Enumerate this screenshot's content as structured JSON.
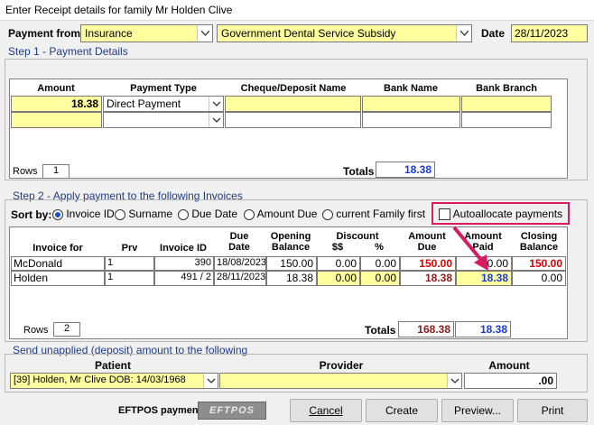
{
  "window": {
    "title": "Enter Receipt details for family Mr  Holden  Clive"
  },
  "header": {
    "payment_from_label": "Payment from",
    "payment_from_value": "Insurance",
    "payer_value": "Government Dental Service Subsidy",
    "date_label": "Date",
    "date_value": "28/11/2023"
  },
  "step1": {
    "title": "Step 1 - Payment Details",
    "columns": [
      "Amount",
      "Payment Type",
      "Cheque/Deposit Name",
      "Bank Name",
      "Bank Branch"
    ],
    "rows": [
      {
        "amount": "18.38",
        "payment_type": "Direct Payment",
        "cheque_name": "",
        "bank_name": "",
        "bank_branch": ""
      },
      {
        "amount": "",
        "payment_type": "",
        "cheque_name": "",
        "bank_name": "",
        "bank_branch": ""
      }
    ],
    "rows_label": "Rows",
    "rows_value": "1",
    "totals_label": "Totals",
    "totals_value": "18.38"
  },
  "step2": {
    "title": "Step 2 - Apply payment to the following Invoices",
    "sort_by_label": "Sort by:",
    "sort_options": [
      "Invoice ID",
      "Surname",
      "Due Date",
      "Amount Due",
      "current Family first"
    ],
    "sort_selected": "Invoice ID",
    "autoallocate_label": "Autoallocate payments",
    "autoallocate_checked": false,
    "columns": {
      "invoice_for": "Invoice for",
      "prv": "Prv",
      "invoice_id": "Invoice ID",
      "due_date_1": "Due",
      "due_date_2": "Date",
      "opening_1": "Opening",
      "opening_2": "Balance",
      "discount": "Discount",
      "discount_dollars": "$$",
      "discount_pct": "%",
      "amount_due_1": "Amount",
      "amount_due_2": "Due",
      "amount_paid_1": "Amount",
      "amount_paid_2": "Paid",
      "closing_1": "Closing",
      "closing_2": "Balance"
    },
    "rows": [
      {
        "invoice_for": "McDonald",
        "prv": "1",
        "invoice_id": "390",
        "due_date": "18/08/2023",
        "opening": "150.00",
        "disc_dollars": "0.00",
        "disc_pct": "0.00",
        "amount_due": "150.00",
        "amount_paid": "0.00",
        "closing": "150.00"
      },
      {
        "invoice_for": "Holden",
        "prv": "1",
        "invoice_id": "491 / 2",
        "due_date": "28/11/2023",
        "opening": "18.38",
        "disc_dollars": "0.00",
        "disc_pct": "0.00",
        "amount_due": "18.38",
        "amount_paid": "18.38",
        "closing": "0.00"
      }
    ],
    "rows_label": "Rows",
    "rows_value": "2",
    "totals_label": "Totals",
    "totals_amount_due": "168.38",
    "totals_amount_paid": "18.38"
  },
  "step3": {
    "title": "Send unapplied (deposit) amount to the following",
    "patient_label": "Patient",
    "provider_label": "Provider",
    "amount_label": "Amount",
    "patient_value": "[39] Holden, Mr Clive DOB: 14/03/1968",
    "provider_value": "",
    "amount_value": ".00"
  },
  "footer": {
    "eftpos_label": "EFTPOS payment",
    "eftpos_button": "EFTPOS",
    "cancel_label": "Cancel",
    "create_label": "Create",
    "preview_label": "Preview...",
    "print_label": "Print"
  },
  "colors": {
    "highlight_box": "#d81b60",
    "field_yellow": "#ffffa0",
    "section_blue": "#1f3c88",
    "total_blue": "#1a3cd6",
    "due_red": "#8b1a1a",
    "closing_red": "#d60000"
  }
}
